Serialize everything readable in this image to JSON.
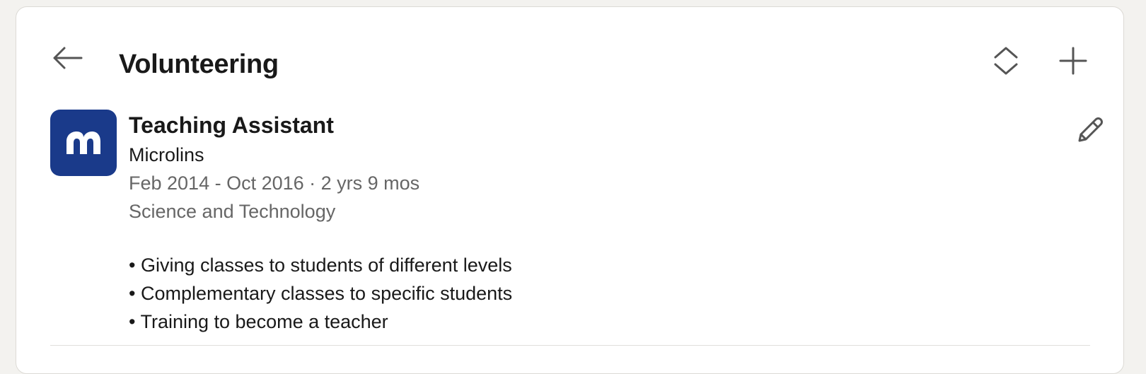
{
  "section": {
    "title": "Volunteering"
  },
  "icons": {
    "back": "arrow-left-icon",
    "reorder": "reorder-icon",
    "add": "plus-icon",
    "edit": "pencil-icon"
  },
  "entry": {
    "role": "Teaching Assistant",
    "organization": "Microlins",
    "dates": "Feb 2014 - Oct 2016 · 2 yrs 9 mos",
    "cause": "Science and Technology",
    "bullets": [
      "• Giving classes to students of different levels",
      "• Complementary classes to specific students",
      "• Training to become a teacher"
    ]
  },
  "colors": {
    "logo_bg": "#1a3a8a",
    "page_bg": "#f3f2ef",
    "card_bg": "#ffffff",
    "secondary_text": "#666666"
  }
}
